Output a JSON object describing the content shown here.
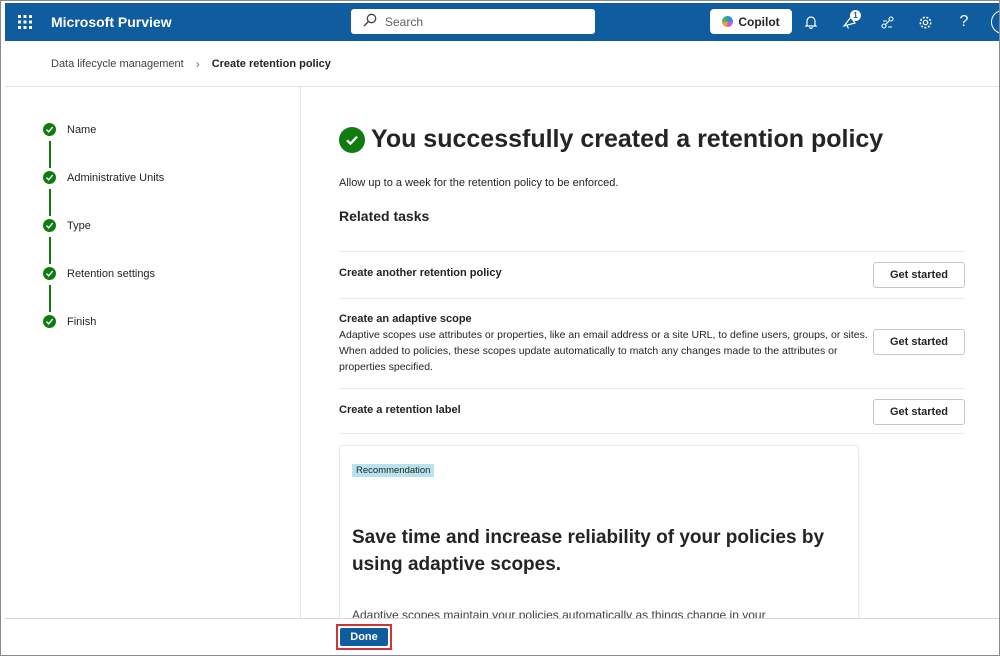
{
  "app": {
    "name": "Microsoft Purview"
  },
  "search": {
    "placeholder": "Search"
  },
  "topbar": {
    "copilot_label": "Copilot",
    "notification_count": "1",
    "icons": [
      "waffle-icon",
      "search-icon",
      "bell-icon",
      "megaphone-icon",
      "connect-icon",
      "gear-icon",
      "help-icon",
      "avatar"
    ]
  },
  "breadcrumb": {
    "items": [
      "Data lifecycle management",
      "Create retention policy"
    ]
  },
  "steps": [
    {
      "label": "Name",
      "status": "complete"
    },
    {
      "label": "Administrative Units",
      "status": "complete"
    },
    {
      "label": "Type",
      "status": "complete"
    },
    {
      "label": "Retention settings",
      "status": "complete"
    },
    {
      "label": "Finish",
      "status": "complete"
    }
  ],
  "main": {
    "title": "You successfully created a retention policy",
    "subtitle": "Allow up to a week for the retention policy to be enforced.",
    "related_title": "Related tasks",
    "tasks": [
      {
        "title": "Create another retention policy",
        "desc": "",
        "button": "Get started"
      },
      {
        "title": "Create an adaptive scope",
        "desc": "Adaptive scopes use attributes or properties, like an email address or a site URL, to define users, groups, or sites. When added to policies, these scopes update automatically to match any changes made to the attributes or properties specified.",
        "button": "Get started"
      },
      {
        "title": "Create a retention label",
        "desc": "",
        "button": "Get started"
      }
    ],
    "recommendation": {
      "badge": "Recommendation",
      "heading": "Save time and increase reliability of your policies by using adaptive scopes.",
      "body": "Adaptive scopes maintain your policies automatically as things change in your"
    }
  },
  "footer": {
    "done_label": "Done"
  },
  "colors": {
    "topbar": "#0f5c9e",
    "success": "#107c10",
    "primary_button": "#0f5c9e",
    "highlight": "#d13438",
    "badge_bg": "#b7e3ec"
  }
}
